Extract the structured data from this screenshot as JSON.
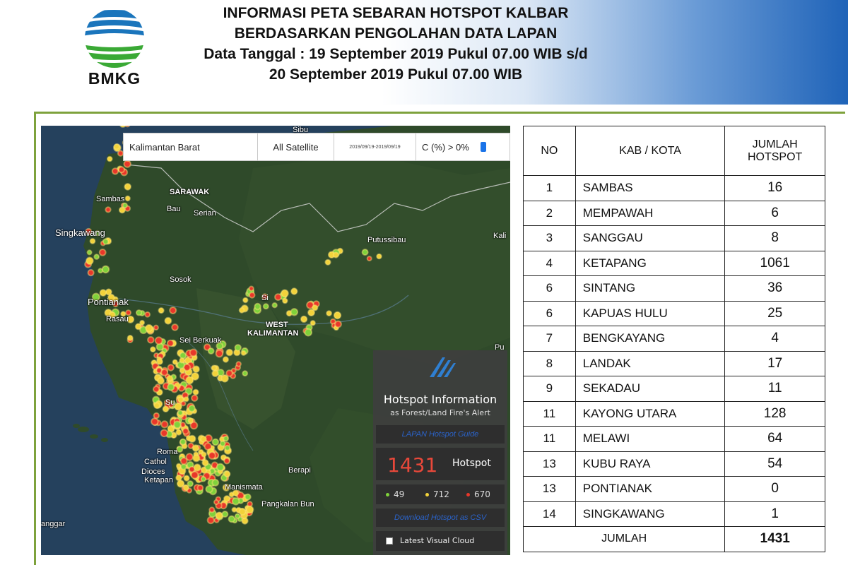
{
  "header": {
    "logo_text": "BMKG",
    "title_lines": [
      "INFORMASI PETA SEBARAN HOTSPOT KALBAR",
      "BERDASARKAN PENGOLAHAN DATA LAPAN",
      "Data Tanggal : 19 September  2019 Pukul 07.00 WIB s/d",
      "20 September 2019 Pukul 07.00 WIB"
    ]
  },
  "map": {
    "search": {
      "region": "Kalimantan Barat",
      "satellite": "All Satellite",
      "date_range": "2019/09/19-2019/09/19",
      "confidence": "C (%) > 0%"
    },
    "places": {
      "sibu": "Sibu",
      "sarawak": "SARAWAK",
      "bau": "Bau",
      "serian": "Serian",
      "sambas": "Sambas",
      "singkawang": "Singkawang",
      "putussibau": "Putussibau",
      "kali": "Kali",
      "sosok": "Sosok",
      "pontianak": "Pontianak",
      "rasau": "Rasau",
      "sintang": "Si",
      "sungai_berkuak": "Sei Berkuak",
      "west_kalimantan_1": "WEST",
      "west_kalimantan_2": "KALIMANTAN",
      "pu": "Pu",
      "sukadana": "Su",
      "roma_1": "Roma",
      "roma_2": "Cathol",
      "roma_3": "Dioces",
      "roma_4": "Ketapan",
      "berapi": "Berapi",
      "manismata": "Manismata",
      "pangkalan_bun": "Pangkalan Bun",
      "tanggar": "anggar"
    },
    "panel": {
      "title": "Hotspot Information",
      "subtitle": "as Forest/Land Fire's Alert",
      "guide_link": "LAPAN Hotspot Guide",
      "total_count": "1431",
      "total_label": "Hotspot",
      "low": "49",
      "medium": "712",
      "high": "670",
      "download_link": "Download Hotspot as CSV",
      "cloud_label": "Latest Visual Cloud"
    },
    "colors": {
      "low": "#7fd13b",
      "medium": "#f2d23a",
      "high": "#e8372a"
    }
  },
  "table": {
    "headers": {
      "no": "NO",
      "kab": "KAB / KOTA",
      "jumlah_1": "JUMLAH",
      "jumlah_2": "HOTSPOT"
    },
    "rows": [
      {
        "no": "1",
        "name": "SAMBAS",
        "value": "16"
      },
      {
        "no": "2",
        "name": "MEMPAWAH",
        "value": "6"
      },
      {
        "no": "3",
        "name": "SANGGAU",
        "value": "8"
      },
      {
        "no": "4",
        "name": "KETAPANG",
        "value": "1061"
      },
      {
        "no": "6",
        "name": "SINTANG",
        "value": "36"
      },
      {
        "no": "6",
        "name": "KAPUAS HULU",
        "value": "25"
      },
      {
        "no": "7",
        "name": "BENGKAYANG",
        "value": "4"
      },
      {
        "no": "8",
        "name": "LANDAK",
        "value": "17"
      },
      {
        "no": "9",
        "name": "SEKADAU",
        "value": "11"
      },
      {
        "no": "11",
        "name": "KAYONG UTARA",
        "value": "128"
      },
      {
        "no": "11",
        "name": "MELAWI",
        "value": "64"
      },
      {
        "no": "13",
        "name": "KUBU RAYA",
        "value": "54"
      },
      {
        "no": "13",
        "name": "PONTIANAK",
        "value": "0"
      },
      {
        "no": "14",
        "name": "SINGKAWANG",
        "value": "1"
      }
    ],
    "total_label": "JUMLAH",
    "total_value": "1431"
  }
}
